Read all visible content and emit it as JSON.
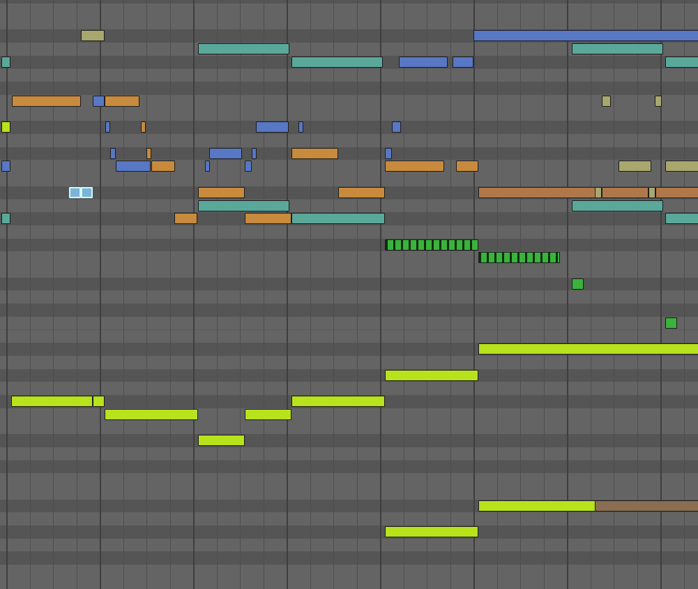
{
  "view": "piano-roll",
  "colors": {
    "row_light": "#646464",
    "row_dark": "#555555",
    "beat_line": "#4e4e4e",
    "bar_line": "#3e3e3e",
    "lime": "#b7e21c",
    "teal": "#5aa89a",
    "orange": "#c88a3c",
    "blue": "#5877c4",
    "khaki": "#a8a76e",
    "green": "#3ab33c",
    "brown": "#8a6e52",
    "brown_orange": "#b0784a",
    "selected_blue": "#7fb3d6"
  },
  "notes": [
    {
      "color": "khaki",
      "s": 3.2,
      "e": 4.2,
      "r": 3
    },
    {
      "color": "blue",
      "s": 20.0,
      "e": 30.0,
      "r": 3
    },
    {
      "color": "teal",
      "s": 8.2,
      "e": 12.1,
      "r": 4
    },
    {
      "color": "teal",
      "s": 24.2,
      "e": 28.1,
      "r": 4
    },
    {
      "color": "teal",
      "s": -0.2,
      "e": 0.2,
      "r": 5
    },
    {
      "color": "teal",
      "s": 12.2,
      "e": 16.1,
      "r": 5
    },
    {
      "color": "blue",
      "s": 16.8,
      "e": 18.9,
      "r": 5
    },
    {
      "color": "blue",
      "s": 19.1,
      "e": 20.0,
      "r": 5
    },
    {
      "color": "teal",
      "s": 28.2,
      "e": 30.0,
      "r": 5
    },
    {
      "color": "orange",
      "s": 0.25,
      "e": 3.2,
      "r": 8
    },
    {
      "color": "blue",
      "s": 3.7,
      "e": 4.2,
      "r": 8
    },
    {
      "color": "orange",
      "s": 4.2,
      "e": 5.7,
      "r": 8
    },
    {
      "color": "khaki",
      "s": 25.5,
      "e": 25.9,
      "r": 8
    },
    {
      "color": "khaki",
      "s": 27.75,
      "e": 28.05,
      "r": 8
    },
    {
      "color": "lime",
      "s": -0.2,
      "e": 0.2,
      "r": 10
    },
    {
      "color": "blue",
      "s": 4.25,
      "e": 4.45,
      "r": 10
    },
    {
      "color": "orange",
      "s": 5.75,
      "e": 5.95,
      "r": 10
    },
    {
      "color": "blue",
      "s": 10.7,
      "e": 12.1,
      "r": 10
    },
    {
      "color": "blue",
      "s": 12.5,
      "e": 12.7,
      "r": 10
    },
    {
      "color": "blue",
      "s": 16.5,
      "e": 16.9,
      "r": 10
    },
    {
      "color": "blue",
      "s": 4.45,
      "e": 4.7,
      "r": 12
    },
    {
      "color": "orange",
      "s": 6.0,
      "e": 6.2,
      "r": 12
    },
    {
      "color": "blue",
      "s": 8.7,
      "e": 10.1,
      "r": 12
    },
    {
      "color": "blue",
      "s": 10.5,
      "e": 10.7,
      "r": 12
    },
    {
      "color": "orange",
      "s": 12.2,
      "e": 14.2,
      "r": 12
    },
    {
      "color": "blue",
      "s": 16.2,
      "e": 16.5,
      "r": 12
    },
    {
      "color": "blue",
      "s": -0.2,
      "e": 0.2,
      "r": 13
    },
    {
      "color": "blue",
      "s": 4.7,
      "e": 6.2,
      "r": 13
    },
    {
      "color": "orange",
      "s": 6.2,
      "e": 7.2,
      "r": 13
    },
    {
      "color": "blue",
      "s": 8.5,
      "e": 8.7,
      "r": 13
    },
    {
      "color": "blue",
      "s": 10.2,
      "e": 10.5,
      "r": 13
    },
    {
      "color": "orange",
      "s": 16.2,
      "e": 18.75,
      "r": 13
    },
    {
      "color": "orange",
      "s": 19.25,
      "e": 20.2,
      "r": 13
    },
    {
      "color": "khaki",
      "s": 26.2,
      "e": 27.6,
      "r": 13
    },
    {
      "color": "khaki",
      "s": 28.2,
      "e": 30.0,
      "r": 13
    },
    {
      "color": "selected_blue",
      "s": 2.7,
      "e": 3.2,
      "r": 15,
      "selected": true
    },
    {
      "color": "selected_blue",
      "s": 3.2,
      "e": 3.7,
      "r": 15,
      "selected": true
    },
    {
      "color": "orange",
      "s": 8.2,
      "e": 10.2,
      "r": 15
    },
    {
      "color": "orange",
      "s": 14.2,
      "e": 16.2,
      "r": 15
    },
    {
      "color": "brown_orange",
      "s": 20.2,
      "e": 25.2,
      "r": 15
    },
    {
      "color": "khaki",
      "s": 25.2,
      "e": 25.5,
      "r": 15
    },
    {
      "color": "brown_orange",
      "s": 25.5,
      "e": 27.5,
      "r": 15
    },
    {
      "color": "khaki",
      "s": 27.5,
      "e": 27.8,
      "r": 15
    },
    {
      "color": "brown_orange",
      "s": 27.8,
      "e": 30.0,
      "r": 15
    },
    {
      "color": "teal",
      "s": 8.2,
      "e": 12.1,
      "r": 16
    },
    {
      "color": "teal",
      "s": 24.2,
      "e": 28.1,
      "r": 16
    },
    {
      "color": "teal",
      "s": -0.2,
      "e": 0.2,
      "r": 17
    },
    {
      "color": "orange",
      "s": 7.2,
      "e": 8.2,
      "r": 17
    },
    {
      "color": "orange",
      "s": 10.2,
      "e": 12.2,
      "r": 17
    },
    {
      "color": "teal",
      "s": 12.2,
      "e": 16.2,
      "r": 17
    },
    {
      "color": "teal",
      "s": 28.2,
      "e": 30.0,
      "r": 17
    },
    {
      "color": "green",
      "s": 16.2,
      "e": 20.2,
      "r": 19,
      "pattern": true
    },
    {
      "color": "green",
      "s": 20.2,
      "e": 23.7,
      "r": 20,
      "pattern": true
    },
    {
      "color": "green",
      "s": 24.2,
      "e": 24.7,
      "r": 22
    },
    {
      "color": "green",
      "s": 28.2,
      "e": 28.7,
      "r": 25
    },
    {
      "color": "lime",
      "s": 20.2,
      "e": 30.0,
      "r": 27
    },
    {
      "color": "lime",
      "s": 16.2,
      "e": 20.2,
      "r": 29
    },
    {
      "color": "lime",
      "s": 0.2,
      "e": 3.7,
      "r": 31
    },
    {
      "color": "lime",
      "s": 3.7,
      "e": 4.2,
      "r": 31
    },
    {
      "color": "lime",
      "s": 12.2,
      "e": 16.2,
      "r": 31
    },
    {
      "color": "lime",
      "s": 4.2,
      "e": 8.2,
      "r": 32
    },
    {
      "color": "lime",
      "s": 10.2,
      "e": 12.2,
      "r": 32
    },
    {
      "color": "lime",
      "s": 8.2,
      "e": 10.2,
      "r": 34
    },
    {
      "color": "lime",
      "s": 20.2,
      "e": 25.2,
      "r": 39
    },
    {
      "color": "brown",
      "s": 25.2,
      "e": 30.0,
      "r": 39
    },
    {
      "color": "lime",
      "s": 16.2,
      "e": 20.2,
      "r": 41
    }
  ]
}
